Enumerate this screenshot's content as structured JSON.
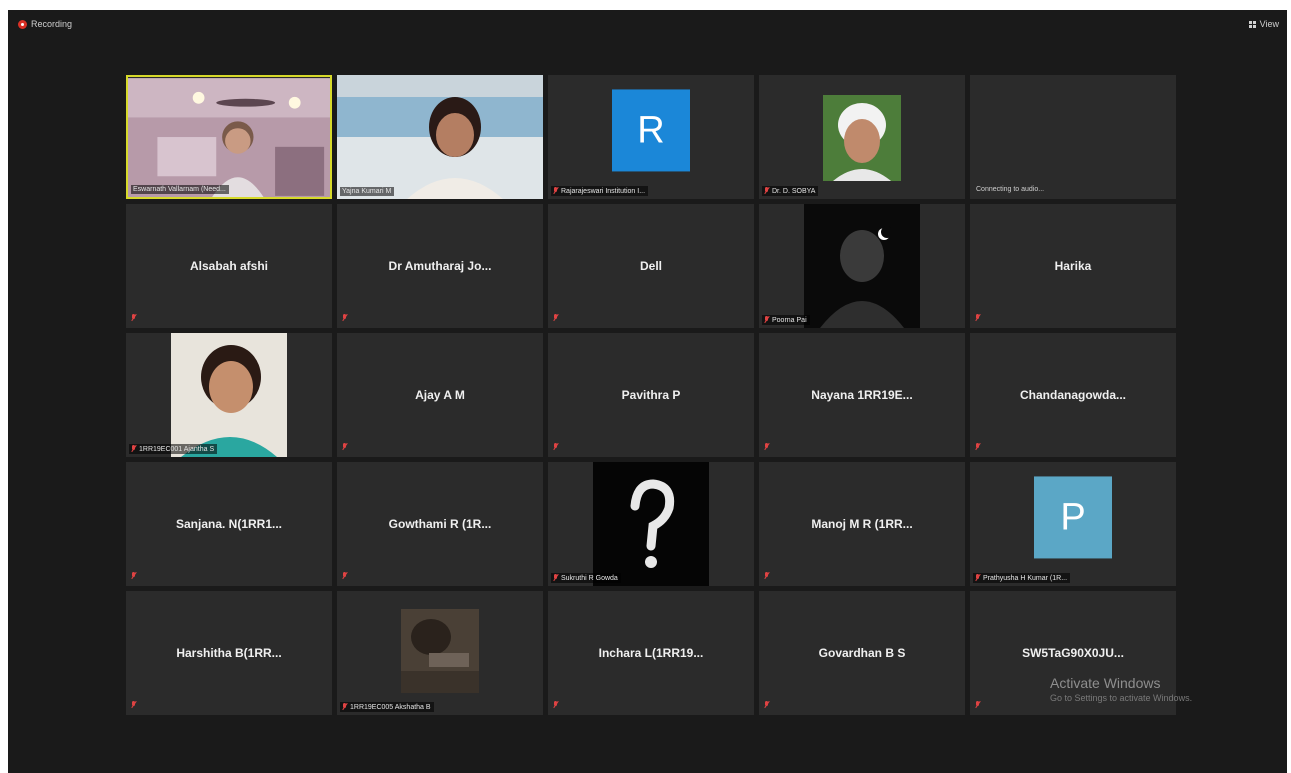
{
  "topbar": {
    "recording_label": "Recording",
    "view_label": "View"
  },
  "colors": {
    "background": "#1a1a1a",
    "tile": "#2b2b2b",
    "active_speaker_border": "#d6d92a",
    "muted_icon": "#e04343",
    "avatar_r": "#1b87d8",
    "avatar_p": "#5ba7c6"
  },
  "tiles": [
    {
      "type": "video",
      "name": "Eswarnath Vallarnam (Need...",
      "active": true
    },
    {
      "type": "video",
      "name": "Yajna Kumari M",
      "active": false
    },
    {
      "type": "avatar",
      "letter": "R",
      "name": "Rajarajeswari Institution I...",
      "muted": true
    },
    {
      "type": "photo",
      "name": "Dr. D. SOBYA",
      "muted": true
    },
    {
      "type": "status",
      "status": "Connecting to audio..."
    },
    {
      "type": "name",
      "name": "Alsabah afshi",
      "muted": true
    },
    {
      "type": "name",
      "name": "Dr Amutharaj Jo...",
      "muted": true
    },
    {
      "type": "name",
      "name": "Dell",
      "muted": true
    },
    {
      "type": "photo",
      "name": "Poorna Pai",
      "muted": true
    },
    {
      "type": "name",
      "name": "Harika",
      "muted": true
    },
    {
      "type": "photo",
      "name": "1RR19EC001 Ajantha S",
      "muted": true
    },
    {
      "type": "name",
      "name": "Ajay A M",
      "muted": true
    },
    {
      "type": "name",
      "name": "Pavithra P",
      "muted": true
    },
    {
      "type": "name",
      "name": "Nayana 1RR19E...",
      "muted": true
    },
    {
      "type": "name",
      "name": "Chandanagowda...",
      "muted": true
    },
    {
      "type": "name",
      "name": "Sanjana. N(1RR1...",
      "muted": true
    },
    {
      "type": "name",
      "name": "Gowthami R (1R...",
      "muted": true
    },
    {
      "type": "photo",
      "name": "Sukruthi R Gowda",
      "muted": true
    },
    {
      "type": "name",
      "name": "Manoj M R (1RR...",
      "muted": true
    },
    {
      "type": "avatar",
      "letter": "P",
      "name": "Prathyusha H Kumar (1R...",
      "muted": true
    },
    {
      "type": "name",
      "name": "Harshitha B(1RR...",
      "muted": true
    },
    {
      "type": "photo",
      "name": "1RR19EC005 Akshatha B",
      "muted": true
    },
    {
      "type": "name",
      "name": "Inchara L(1RR19...",
      "muted": true
    },
    {
      "type": "name",
      "name": "Govardhan B S",
      "muted": true
    },
    {
      "type": "name",
      "name": "SW5TaG90X0JU...",
      "muted": true
    }
  ],
  "watermark": {
    "title": "Activate Windows",
    "subtitle": "Go to Settings to activate Windows."
  }
}
